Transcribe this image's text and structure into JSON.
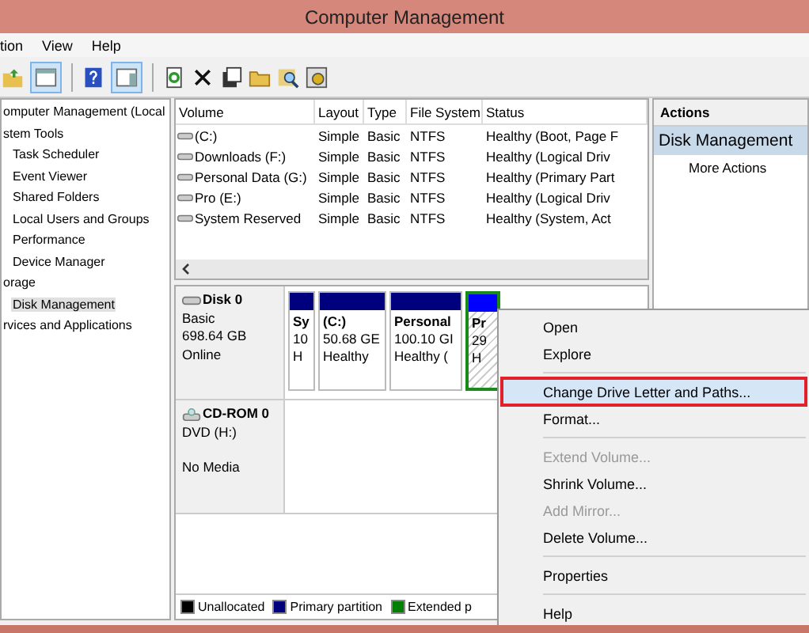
{
  "window": {
    "title": "Computer Management"
  },
  "menu": [
    "tion",
    "View",
    "Help"
  ],
  "tree": [
    {
      "label": "omputer Management (Local",
      "selected": false,
      "children": [
        {
          "label": "stem Tools",
          "selected": false,
          "children": [
            {
              "label": "Task Scheduler",
              "selected": false
            },
            {
              "label": "Event Viewer",
              "selected": false
            },
            {
              "label": "Shared Folders",
              "selected": false
            },
            {
              "label": "Local Users and Groups",
              "selected": false
            },
            {
              "label": "Performance",
              "selected": false
            },
            {
              "label": "Device Manager",
              "selected": false
            }
          ]
        },
        {
          "label": "orage",
          "selected": false,
          "children": [
            {
              "label": "Disk Management",
              "selected": true
            }
          ]
        },
        {
          "label": "rvices and Applications",
          "selected": false
        }
      ]
    }
  ],
  "volume_table": {
    "columns": [
      "Volume",
      "Layout",
      "Type",
      "File System",
      "Status"
    ],
    "rows": [
      [
        "(C:)",
        "Simple",
        "Basic",
        "NTFS",
        "Healthy (Boot, Page F"
      ],
      [
        "Downloads (F:)",
        "Simple",
        "Basic",
        "NTFS",
        "Healthy (Logical Driv"
      ],
      [
        "Personal Data (G:)",
        "Simple",
        "Basic",
        "NTFS",
        "Healthy (Primary Part"
      ],
      [
        "Pro (E:)",
        "Simple",
        "Basic",
        "NTFS",
        "Healthy (Logical Driv"
      ],
      [
        "System Reserved",
        "Simple",
        "Basic",
        "NTFS",
        "Healthy (System, Act"
      ]
    ]
  },
  "disks": [
    {
      "kind": "hdd",
      "name": "Disk 0",
      "lines": [
        "Basic",
        "698.64 GB",
        "Online"
      ],
      "partitions": [
        {
          "kind": "primary",
          "lines": [
            "Sy",
            "10",
            "H"
          ]
        },
        {
          "kind": "primary",
          "lines": [
            "(C:)",
            "50.68 GE",
            "Healthy"
          ]
        },
        {
          "kind": "primary",
          "lines": [
            "Personal",
            "100.10 GI",
            "Healthy ("
          ]
        },
        {
          "kind": "extended",
          "lines": [
            "Pr",
            "29",
            "H"
          ]
        }
      ]
    },
    {
      "kind": "cdrom",
      "name": "CD-ROM 0",
      "lines": [
        "DVD (H:)"
      ],
      "status": "No Media"
    }
  ],
  "legend": [
    {
      "label": "Unallocated",
      "color": "#000000"
    },
    {
      "label": "Primary partition",
      "color": "#00007f"
    },
    {
      "label": "Extended p",
      "color": "#007f00"
    }
  ],
  "actions": {
    "title": "Actions",
    "section": "Disk Management",
    "items": [
      "More Actions"
    ]
  },
  "context_menu": [
    {
      "kind": "item",
      "label": "Open",
      "disabled": false,
      "selected": false
    },
    {
      "kind": "item",
      "label": "Explore",
      "disabled": false,
      "selected": false
    },
    {
      "kind": "separator"
    },
    {
      "kind": "item",
      "label": "Change Drive Letter and Paths...",
      "disabled": false,
      "selected": true
    },
    {
      "kind": "item",
      "label": "Format...",
      "disabled": false,
      "selected": false
    },
    {
      "kind": "separator"
    },
    {
      "kind": "item",
      "label": "Extend Volume...",
      "disabled": true,
      "selected": false
    },
    {
      "kind": "item",
      "label": "Shrink Volume...",
      "disabled": false,
      "selected": false
    },
    {
      "kind": "item",
      "label": "Add Mirror...",
      "disabled": true,
      "selected": false
    },
    {
      "kind": "item",
      "label": "Delete Volume...",
      "disabled": false,
      "selected": false
    },
    {
      "kind": "separator"
    },
    {
      "kind": "item",
      "label": "Properties",
      "disabled": false,
      "selected": false
    },
    {
      "kind": "separator"
    },
    {
      "kind": "item",
      "label": "Help",
      "disabled": false,
      "selected": false
    }
  ]
}
